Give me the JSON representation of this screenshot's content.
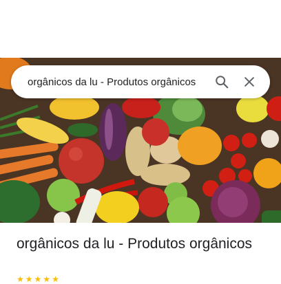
{
  "search": {
    "query": "orgânicos da lu - Produtos orgânicos"
  },
  "icons": {
    "search": "search-icon",
    "clear": "close-icon"
  },
  "listing": {
    "title": "orgânicos da lu - Produtos orgânicos",
    "rating": 5
  },
  "colors": {
    "icon": "#5f6368",
    "text": "#202124",
    "star": "#fbbc04"
  }
}
